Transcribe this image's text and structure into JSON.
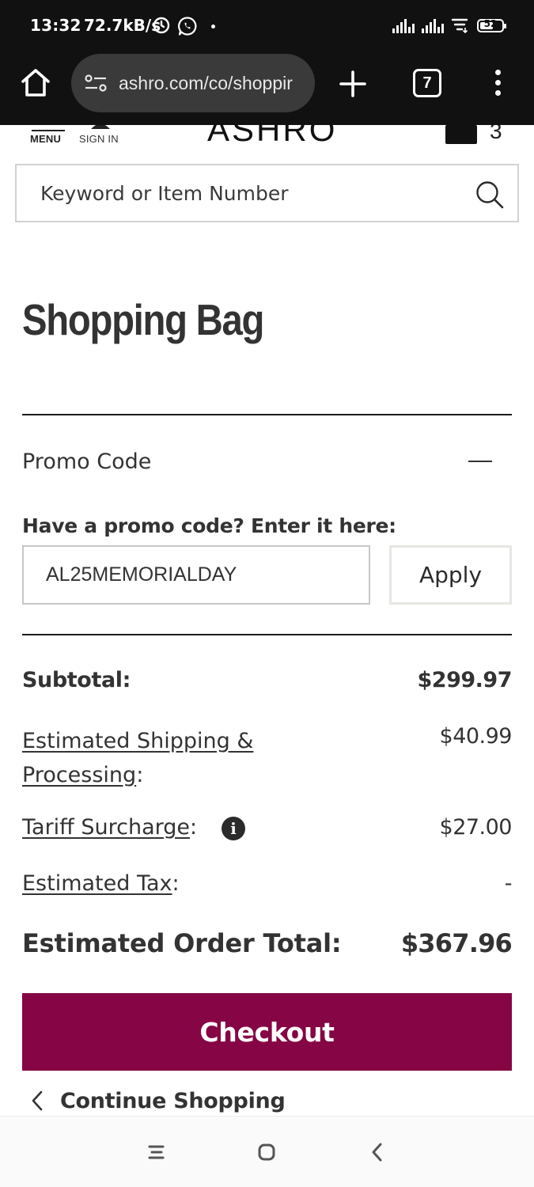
{
  "status_bar": {
    "time": "13:32",
    "speed": "72.7kB/s",
    "battery": "52",
    "battery_level": 0.52
  },
  "browser": {
    "url": "ashro.com/co/shoppir",
    "tab_count": "7"
  },
  "header": {
    "menu_label": "MENU",
    "signin_label": "SIGN IN",
    "logo": "ASHRO",
    "bag_count": "3"
  },
  "search": {
    "placeholder": "Keyword or Item Number"
  },
  "bag": {
    "title": "Shopping Bag",
    "promo": {
      "heading": "Promo Code",
      "label": "Have a promo code? Enter it here:",
      "value": "AL25MEMORIALDAY",
      "apply_label": "Apply"
    },
    "summary": {
      "subtotal_label": "Subtotal:",
      "subtotal_value": "$299.97",
      "shipping_label_line1": "Estimated Shipping &",
      "shipping_label_line2": "Processing",
      "shipping_value": "$40.99",
      "tariff_label": "Tariff Surcharge",
      "tariff_value": "$27.00",
      "tax_label": "Estimated Tax",
      "tax_value": "-",
      "total_label": "Estimated Order Total:",
      "total_value": "$367.96"
    },
    "checkout_label": "Checkout",
    "continue_label": "Continue Shopping"
  },
  "colors": {
    "accent": "#860544",
    "system_bar": "#111111",
    "text": "#333333"
  },
  "icons": {
    "status": [
      "alarm-icon",
      "whatsapp-icon",
      "signal-icon",
      "wifi-icon",
      "battery-icon"
    ],
    "browser": [
      "home-icon",
      "site-settings-icon",
      "new-tab-icon",
      "tab-switcher-icon",
      "more-icon"
    ],
    "page": [
      "menu-icon",
      "user-icon",
      "bag-icon",
      "search-icon",
      "info-icon",
      "chevron-left-icon"
    ],
    "nav": [
      "recents-icon",
      "home-icon",
      "back-icon"
    ]
  }
}
